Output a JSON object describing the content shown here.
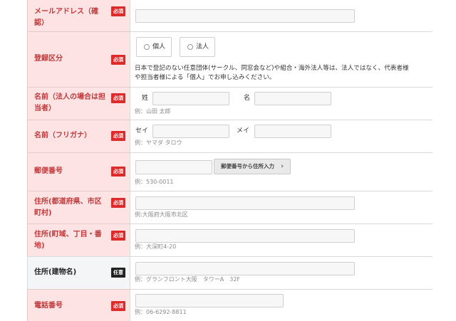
{
  "rows": {
    "email_confirm": {
      "label": "メールアドレス（確認）",
      "badge": "必須"
    },
    "registration": {
      "label": "登録区分",
      "badge": "必須",
      "options": [
        "個人",
        "法人"
      ],
      "description_line1": "日本で登記のない任意団体(サークル、同窓会など)や組合・海外法人等は、法人ではなく、代表者様",
      "description_line2": "や担当者様による「個人」でお申し込みください。"
    },
    "name": {
      "label": "名前（法人の場合は担当者）",
      "badge": "必須",
      "last_label": "姓",
      "first_label": "名",
      "hint": "例：山田 太郎"
    },
    "name_kana": {
      "label": "名前（フリガナ）",
      "badge": "必須",
      "last_label": "セイ",
      "first_label": "メイ",
      "hint": "例：ヤマダ タロウ"
    },
    "postal": {
      "label": "郵便番号",
      "badge": "必須",
      "button": "郵便番号から住所入力",
      "hint": "例：530-0011"
    },
    "address1": {
      "label": "住所(都道府県、市区町村)",
      "badge": "必須",
      "hint": "例:大阪府大阪市北区"
    },
    "address2": {
      "label": "住所(町域、丁目・番地)",
      "badge": "必須",
      "hint": "例：大深町4-20"
    },
    "building": {
      "label": "住所(建物名)",
      "badge": "任意",
      "hint": "例：グランフロント大阪　タワーA　32F"
    },
    "phone": {
      "label": "電話番号",
      "badge": "必須",
      "hint": "例：06-6292-8811"
    }
  },
  "colors": {
    "required_label_bg": "#fde3e3",
    "required_label_text": "#c0393b",
    "required_badge": "#dd2a2a",
    "optional_badge": "#222222",
    "optional_label_bg": "#f3f5f7"
  }
}
